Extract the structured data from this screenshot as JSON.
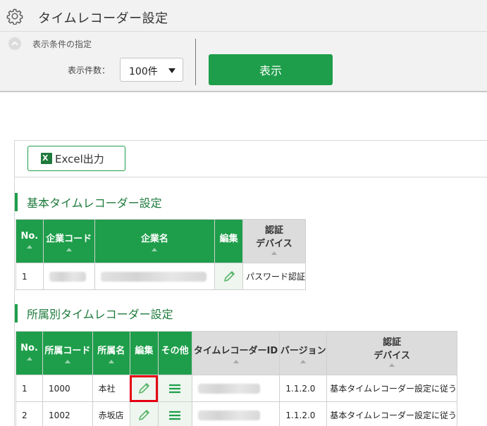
{
  "header": {
    "title": "タイムレコーダー設定",
    "icon": "gear-icon"
  },
  "filters": {
    "section_label": "表示条件の指定",
    "count_label": "表示件数：",
    "count_value": "100件",
    "show_button": "表示"
  },
  "toolbar": {
    "excel_label": "Excel出力",
    "excel_icon_text": "X"
  },
  "basic": {
    "title": "基本タイムレコーダー設定",
    "headers": [
      "No.",
      "企業コード",
      "企業名",
      "編集",
      "認証\nデバイス"
    ],
    "rows": [
      {
        "no": "1",
        "auth": "パスワード認証"
      }
    ]
  },
  "dept": {
    "title": "所属別タイムレコーダー設定",
    "headers": [
      "No.",
      "所属コード",
      "所属名",
      "編集",
      "その他",
      "タイムレコーダーID",
      "バージョン",
      "認証\nデバイス"
    ],
    "rows": [
      {
        "no": "1",
        "code": "1000",
        "name": "本社",
        "version": "1.1.2.0",
        "auth": "基本タイムレコーダー設定に従う"
      },
      {
        "no": "2",
        "code": "1002",
        "name": "赤坂店",
        "version": "1.1.2.0",
        "auth": "基本タイムレコーダー設定に従う"
      }
    ]
  },
  "colors": {
    "accent": "#1e9e4a",
    "highlight": "#e60012"
  }
}
